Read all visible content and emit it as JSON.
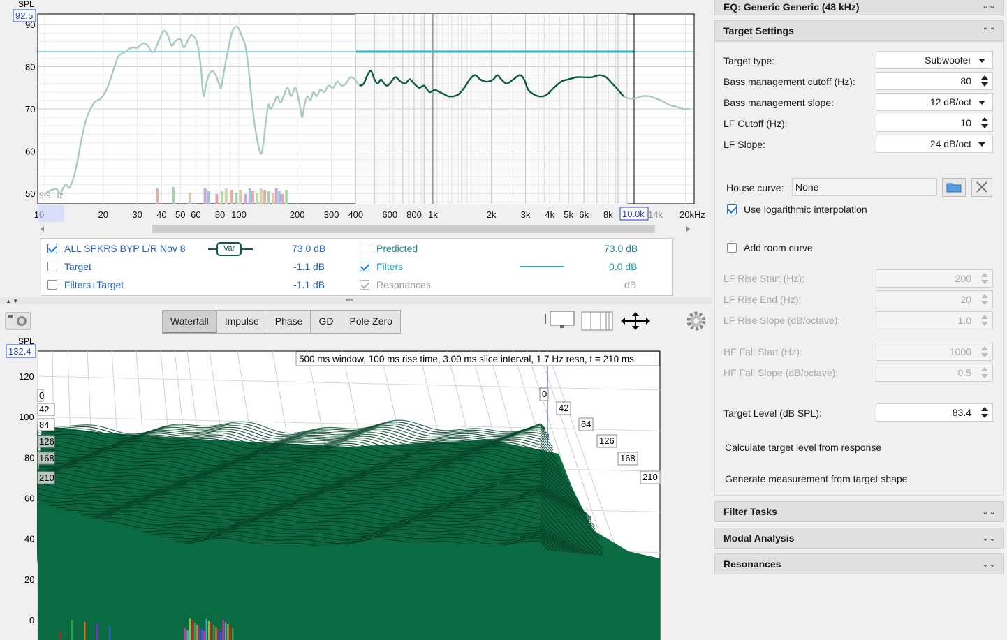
{
  "top_chart": {
    "y_label": "SPL",
    "y_cursor_value": "92.5",
    "y_ticks": [
      "90",
      "80",
      "70",
      "60",
      "50"
    ],
    "x_ticks": [
      "10",
      "20",
      "30",
      "40",
      "50",
      "60",
      "80",
      "100",
      "200",
      "300",
      "400",
      "600",
      "800",
      "1k",
      "2k",
      "3k",
      "4k",
      "5k",
      "6k",
      "8k",
      "14k",
      "20kHz"
    ],
    "x_cursor_value": "10.0k",
    "low_freq_note": "9.9 Hz",
    "target_level_db": 83.4
  },
  "legend": {
    "rows": [
      {
        "label": "ALL SPKRS BYP L/R Nov 8",
        "value": "73.0 dB",
        "checked": true
      },
      {
        "label": "Target",
        "value": "-1.1 dB",
        "checked": false
      },
      {
        "label": "Filters+Target",
        "value": "-1.1 dB",
        "checked": false
      }
    ],
    "var_label": "Var",
    "right_rows": [
      {
        "label": "Predicted",
        "value": "73.0 dB",
        "checked": false
      },
      {
        "label": "Filters",
        "value": "0.0 dB",
        "checked": true
      },
      {
        "label": "Resonances",
        "value": "dB",
        "checked": true,
        "disabled": true
      }
    ]
  },
  "tabs": [
    "Waterfall",
    "Impulse",
    "Phase",
    "GD",
    "Pole-Zero"
  ],
  "active_tab": "Waterfall",
  "waterfall": {
    "y_label": "SPL",
    "y_cursor_value": "132.4",
    "y_ticks": [
      "120",
      "100",
      "80",
      "60",
      "40",
      "20",
      "0"
    ],
    "info": "500 ms window, 100 ms rise time, 3.00 ms slice interval, 1.7 Hz resn, t = 210 ms",
    "slice_labels_left": [
      "0",
      "42",
      "84",
      "126",
      "168",
      "210"
    ],
    "slice_labels_right": [
      "0",
      "42",
      "84",
      "126",
      "168",
      "210"
    ]
  },
  "eq_header": "EQ: Generic Generic (48 kHz)",
  "target_settings": {
    "title": "Target Settings",
    "target_type_label": "Target type:",
    "target_type": "Subwoofer",
    "bm_cutoff_label": "Bass management cutoff (Hz):",
    "bm_cutoff": "80",
    "bm_slope_label": "Bass management slope:",
    "bm_slope": "12 dB/oct",
    "lf_cutoff_label": "LF Cutoff (Hz):",
    "lf_cutoff": "10",
    "lf_slope_label": "LF Slope:",
    "lf_slope": "24 dB/oct",
    "house_curve_label": "House curve:",
    "house_curve": "None",
    "log_interp_label": "Use logarithmic interpolation",
    "room_curve_label": "Add room curve",
    "lf_rise_start_label": "LF Rise Start (Hz):",
    "lf_rise_start": "200",
    "lf_rise_end_label": "LF Rise End (Hz):",
    "lf_rise_end": "20",
    "lf_rise_slope_label": "LF Rise Slope (dB/octave):",
    "lf_rise_slope": "1.0",
    "hf_fall_start_label": "HF Fall Start (Hz):",
    "hf_fall_start": "1000",
    "hf_fall_slope_label": "HF Fall Slope (dB/octave):",
    "hf_fall_slope": "0.5",
    "target_level_label": "Target Level (dB SPL):",
    "target_level": "83.4",
    "calc_label": "Calculate target level from response",
    "gen_label": "Generate measurement from target shape"
  },
  "sections": [
    "Filter Tasks",
    "Modal Analysis",
    "Resonances"
  ],
  "colors": {
    "measurement": "#0d5c44",
    "measurement_light": "#a8ccc0",
    "target_line": "#8fd6e6",
    "filters_line": "#29b3bd",
    "waterfall": "#0b6b42"
  }
}
